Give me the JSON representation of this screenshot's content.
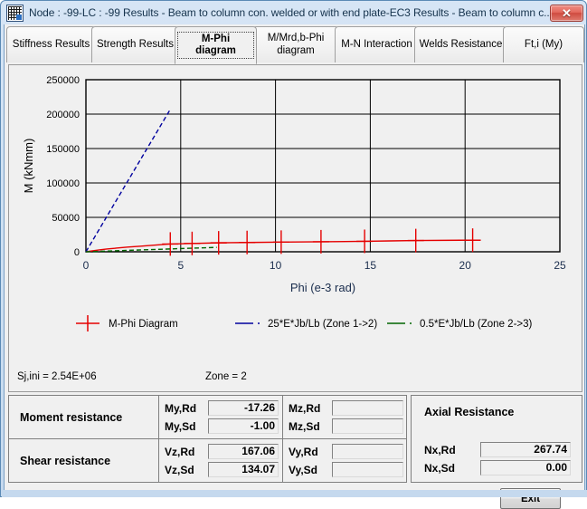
{
  "window": {
    "title": "Node : -99-LC : -99  Results - Beam to column con. welded or with end plate-EC3 Results - Beam to column c...",
    "close_label": "✕",
    "app_icon": "application-icon"
  },
  "tabs": [
    {
      "label": "Stiffness Results",
      "selected": false
    },
    {
      "label": "Strength Results",
      "selected": false
    },
    {
      "label": "M-Phi diagram",
      "selected": true
    },
    {
      "label": "M/Mrd,b-Phi diagram",
      "selected": false
    },
    {
      "label": "M-N Interaction",
      "selected": false
    },
    {
      "label": "Welds Resistance",
      "selected": false
    },
    {
      "label": "Ft,i (My)",
      "selected": false
    }
  ],
  "chart_data": {
    "type": "line",
    "title": "",
    "xlabel": "Phi (e-3 rad)",
    "ylabel": "M (kNmm)",
    "xlim": [
      0,
      25
    ],
    "ylim": [
      0,
      250000
    ],
    "xticks": [
      0,
      5,
      10,
      15,
      20,
      25
    ],
    "yticks": [
      0,
      50000,
      100000,
      150000,
      200000,
      250000
    ],
    "xtick_labels": [
      "0",
      "5",
      "10",
      "15",
      "20",
      "25"
    ],
    "ytick_labels": [
      "0",
      "50000",
      "100000",
      "150000",
      "200000",
      "250000"
    ],
    "grid": true,
    "legend_position": "bottom",
    "series": [
      {
        "name": "M-Phi Diagram",
        "color": "#e50000",
        "style": "solid-with-plus-markers",
        "points": [
          [
            0.0,
            0
          ],
          [
            0.35,
            1400
          ],
          [
            0.7,
            2700
          ],
          [
            1.1,
            4000
          ],
          [
            1.6,
            5300
          ],
          [
            2.2,
            6800
          ],
          [
            2.9,
            8200
          ],
          [
            3.6,
            9600
          ],
          [
            4.4,
            11200
          ],
          [
            4.45,
            11300
          ],
          [
            5.6,
            12100
          ],
          [
            7.0,
            13000
          ],
          [
            8.5,
            13500
          ],
          [
            10.3,
            14000
          ],
          [
            12.4,
            14600
          ],
          [
            14.7,
            15200
          ],
          [
            16.0,
            15800
          ],
          [
            17.4,
            16300
          ],
          [
            20.4,
            16900
          ],
          [
            20.8,
            16900
          ]
        ],
        "markers_x": [
          4.45,
          5.6,
          7.0,
          8.5,
          10.3,
          12.4,
          14.7,
          17.4,
          20.4
        ]
      },
      {
        "name": "25*E*Jb/Lb (Zone 1->2)",
        "color": "#00009e",
        "style": "dashed",
        "points": [
          [
            0.0,
            0
          ],
          [
            4.45,
            207000
          ]
        ]
      },
      {
        "name": "0.5*E*Jb/Lb (Zone 2->3)",
        "color": "#006400",
        "style": "dashed",
        "points": [
          [
            0.0,
            0
          ],
          [
            6.9,
            6400
          ]
        ]
      }
    ],
    "legend": [
      {
        "label": "M-Phi Diagram",
        "color": "#e50000",
        "marker": "plus",
        "style": "solid"
      },
      {
        "label": "25*E*Jb/Lb (Zone 1->2)",
        "color": "#00009e",
        "marker": "none",
        "style": "dashdot"
      },
      {
        "label": "0.5*E*Jb/Lb (Zone 2->3)",
        "color": "#006400",
        "marker": "none",
        "style": "dashdot"
      }
    ]
  },
  "footer_info": {
    "sj_ini": "Sj,ini = 2.54E+06",
    "zone": "Zone = 2"
  },
  "results": {
    "moment": {
      "title": "Moment resistance",
      "rows": [
        {
          "label": "My,Rd",
          "value": "-17.26"
        },
        {
          "label": "My,Sd",
          "value": "-1.00"
        }
      ],
      "rows2": [
        {
          "label": "Mz,Rd",
          "value": ""
        },
        {
          "label": "Mz,Sd",
          "value": ""
        }
      ]
    },
    "shear": {
      "title": "Shear resistance",
      "rows": [
        {
          "label": "Vz,Rd",
          "value": "167.06"
        },
        {
          "label": "Vz,Sd",
          "value": "134.07"
        }
      ],
      "rows2": [
        {
          "label": "Vy,Rd",
          "value": ""
        },
        {
          "label": "Vy,Sd",
          "value": ""
        }
      ]
    },
    "axial": {
      "title": "Axial Resistance",
      "rows": [
        {
          "label": "Nx,Rd",
          "value": "267.74"
        },
        {
          "label": "Nx,Sd",
          "value": "0.00"
        }
      ]
    }
  },
  "buttons": {
    "exit": "Exit"
  }
}
